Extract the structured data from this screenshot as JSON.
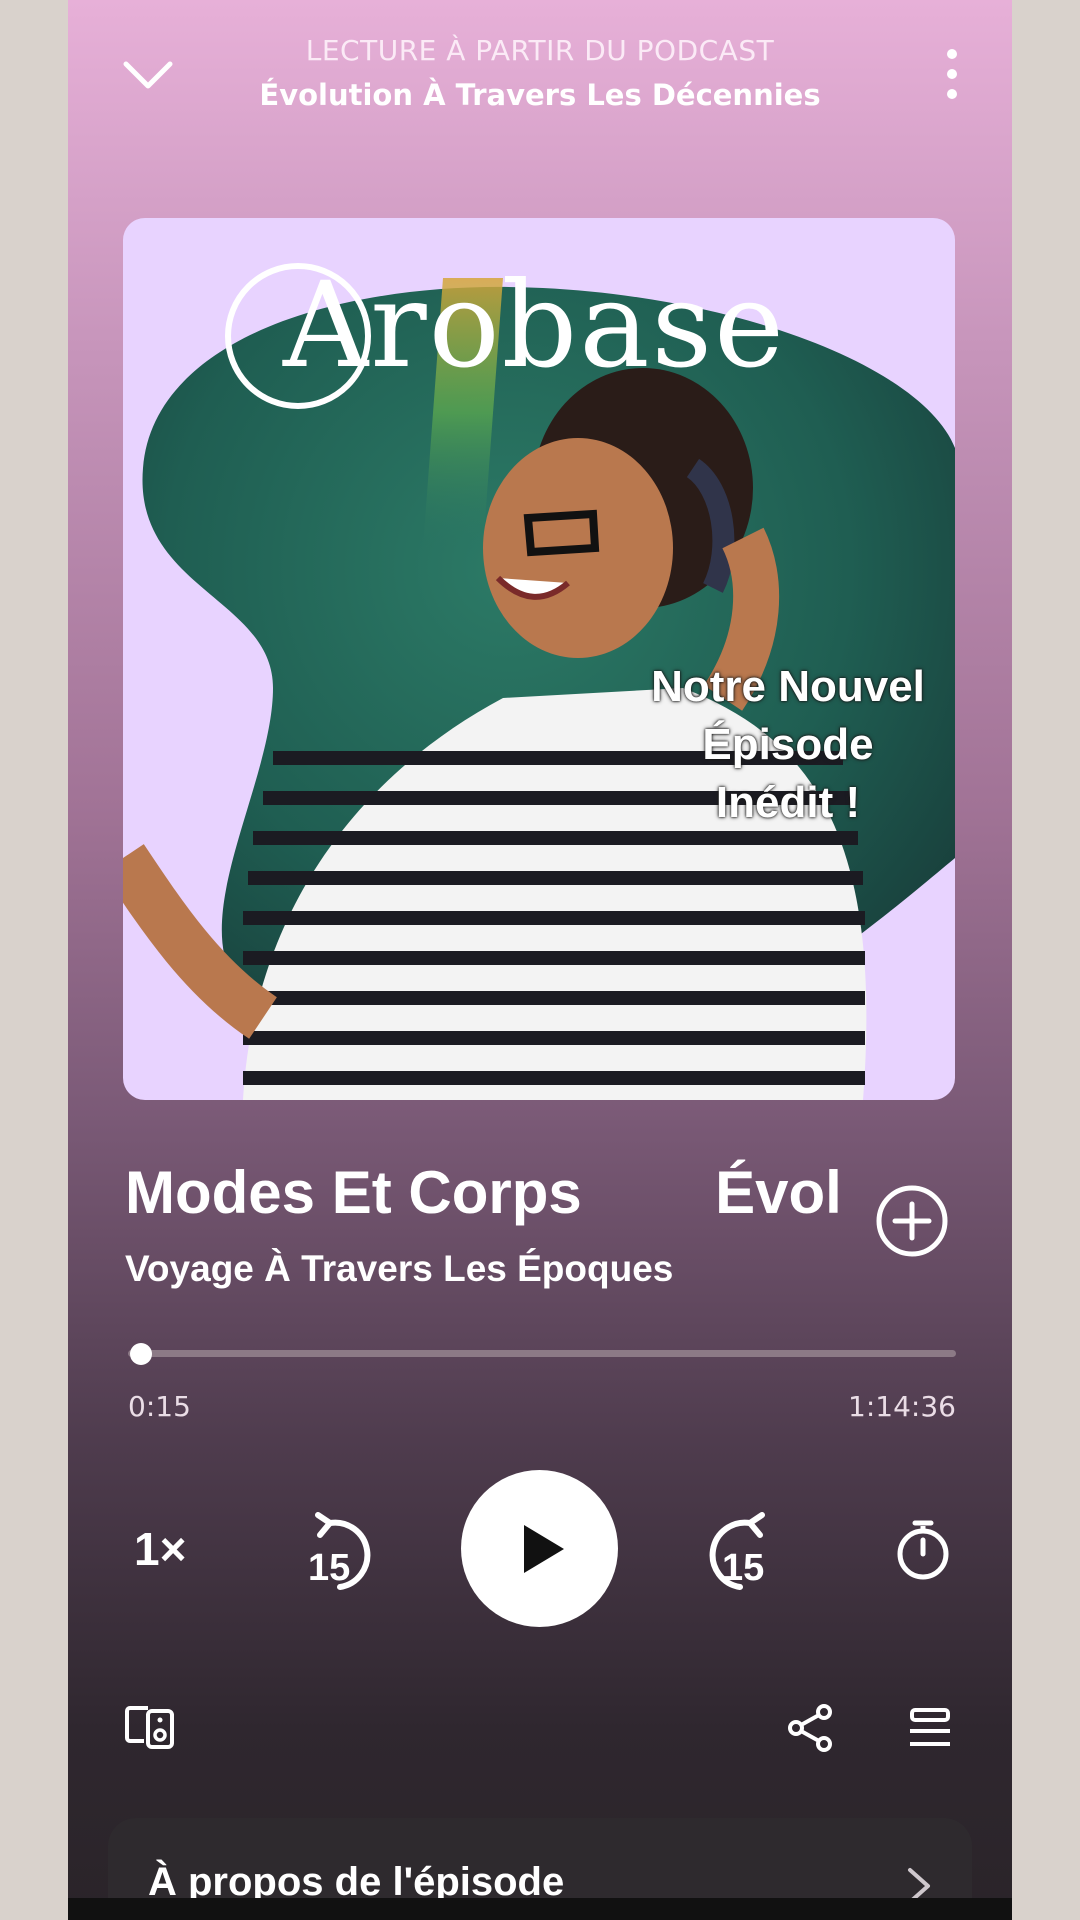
{
  "header": {
    "context_label": "LECTURE À PARTIR DU PODCAST",
    "podcast_title": "Évolution À Travers Les Décennies",
    "collapse_icon": "chevron-down-icon",
    "menu_icon": "more-vertical-icon"
  },
  "artwork": {
    "brand": "Arobase",
    "overlay_lines": [
      "Notre Nouvel",
      "Épisode",
      "Inédit !"
    ]
  },
  "episode": {
    "title": "Modes Et Corps        Évol",
    "subtitle": "Voyage À Travers Les Époques",
    "add_icon": "plus-circle-icon"
  },
  "progress": {
    "elapsed": "0:15",
    "duration": "1:14:36",
    "fraction": 0.003
  },
  "controls": {
    "speed_label": "1×",
    "rewind_label": "15",
    "forward_label": "15",
    "play_icon": "play-icon",
    "timer_icon": "sleep-timer-icon"
  },
  "bottom_bar": {
    "device_icon": "connect-device-icon",
    "share_icon": "share-icon",
    "queue_icon": "queue-icon"
  },
  "about": {
    "label": "À propos de l'épisode"
  },
  "colors": {
    "gradient_top": "#e7b0d8",
    "gradient_bottom": "#2a2429",
    "artwork_bg": "#e8d3ff",
    "artwork_blob": "#1d5a4e"
  }
}
